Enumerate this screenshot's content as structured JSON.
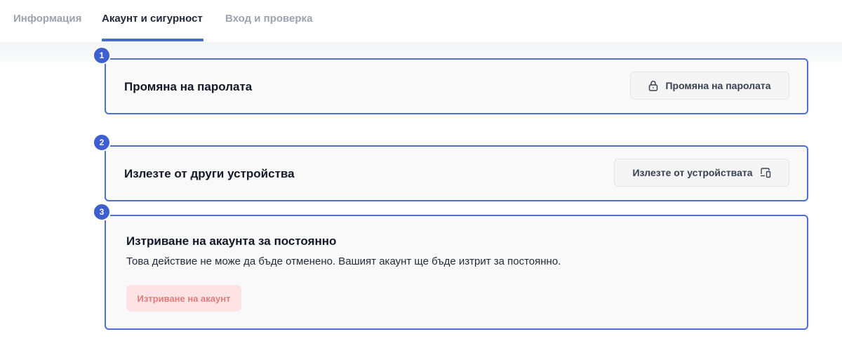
{
  "tabs": [
    {
      "label": "Информация"
    },
    {
      "label": "Акаунт и сигурност"
    },
    {
      "label": "Вход и проверка"
    }
  ],
  "cards": [
    {
      "badge": "1",
      "title": "Промяна на паролата",
      "button_label": "Промяна на паролата",
      "button_icon": "lock-icon"
    },
    {
      "badge": "2",
      "title": "Излезте от други устройства",
      "button_label": "Излезте от устройствата",
      "button_icon": "devices-icon"
    },
    {
      "badge": "3",
      "title": "Изтриване на акаунта за постоянно",
      "description": "Това действие не може да бъде отменено. Вашият акаунт ще бъде изтрит за постоянно.",
      "button_label": "Изтриване на акаунт"
    }
  ],
  "colors": {
    "accent": "#4a6cc9",
    "card_border": "#4f6fd6",
    "badge": "#3d5fcf",
    "danger_bg": "#fde3e3",
    "danger_text": "#e07b7b"
  }
}
